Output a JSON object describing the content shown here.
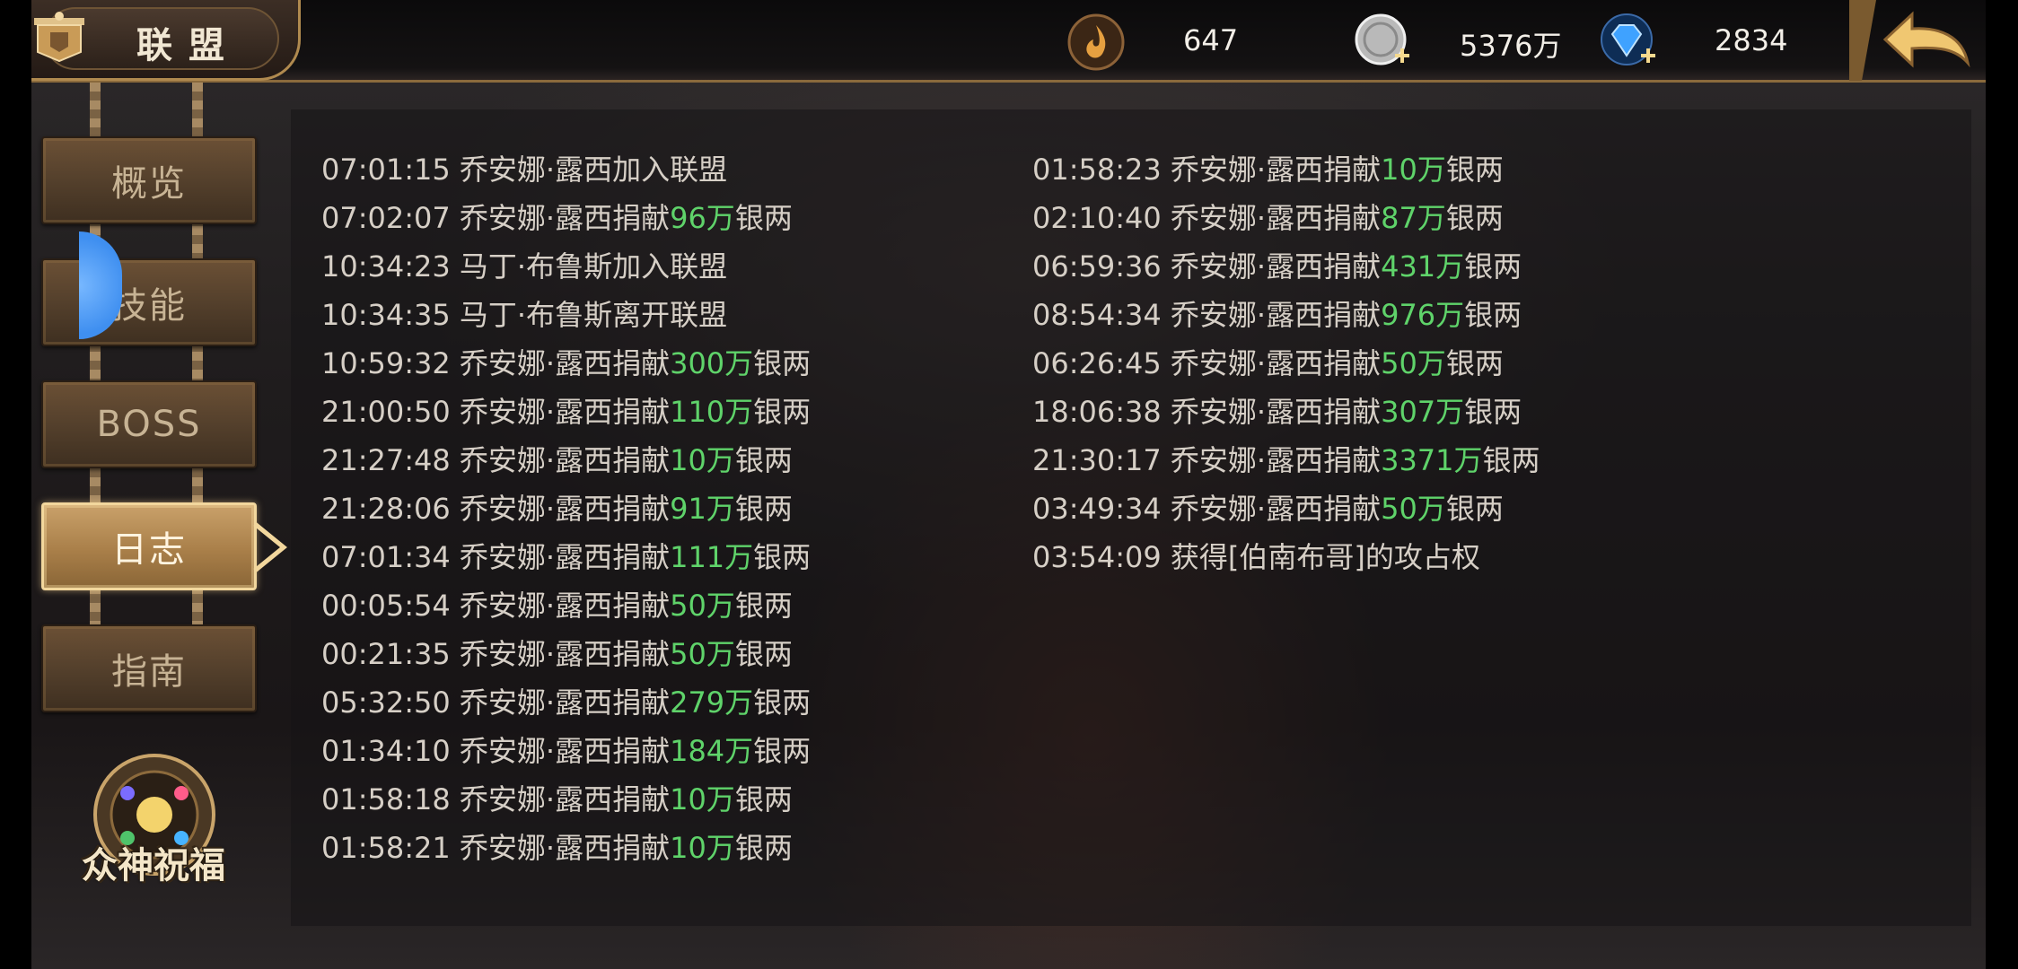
{
  "header": {
    "title": "联盟",
    "resources": [
      {
        "icon": "flame-coin-icon",
        "value": "647"
      },
      {
        "icon": "silver-coin-add-icon",
        "value": "5376万"
      },
      {
        "icon": "diamond-add-icon",
        "value": "2834"
      }
    ],
    "back_icon": "back-arrow-icon"
  },
  "sidebar": {
    "items": [
      {
        "label": "概览",
        "active": false
      },
      {
        "label": "技能",
        "active": false
      },
      {
        "label": "BOSS",
        "active": false
      },
      {
        "label": "日志",
        "active": true
      },
      {
        "label": "指南",
        "active": false
      }
    ],
    "blessing_label": "众神祝福"
  },
  "log": {
    "left": [
      {
        "time": "07:01:15",
        "pre": "乔安娜·露西加入联盟",
        "amt": "",
        "post": ""
      },
      {
        "time": "07:02:07",
        "pre": "乔安娜·露西捐献",
        "amt": "96万",
        "post": "银两"
      },
      {
        "time": "10:34:23",
        "pre": "马丁·布鲁斯加入联盟",
        "amt": "",
        "post": ""
      },
      {
        "time": "10:34:35",
        "pre": "马丁·布鲁斯离开联盟",
        "amt": "",
        "post": ""
      },
      {
        "time": "10:59:32",
        "pre": "乔安娜·露西捐献",
        "amt": "300万",
        "post": "银两"
      },
      {
        "time": "21:00:50",
        "pre": "乔安娜·露西捐献",
        "amt": "110万",
        "post": "银两"
      },
      {
        "time": "21:27:48",
        "pre": "乔安娜·露西捐献",
        "amt": "10万",
        "post": "银两"
      },
      {
        "time": "21:28:06",
        "pre": "乔安娜·露西捐献",
        "amt": "91万",
        "post": "银两"
      },
      {
        "time": "07:01:34",
        "pre": "乔安娜·露西捐献",
        "amt": "111万",
        "post": "银两"
      },
      {
        "time": "00:05:54",
        "pre": "乔安娜·露西捐献",
        "amt": "50万",
        "post": "银两"
      },
      {
        "time": "00:21:35",
        "pre": "乔安娜·露西捐献",
        "amt": "50万",
        "post": "银两"
      },
      {
        "time": "05:32:50",
        "pre": "乔安娜·露西捐献",
        "amt": "279万",
        "post": "银两"
      },
      {
        "time": "01:34:10",
        "pre": "乔安娜·露西捐献",
        "amt": "184万",
        "post": "银两"
      },
      {
        "time": "01:58:18",
        "pre": "乔安娜·露西捐献",
        "amt": "10万",
        "post": "银两"
      },
      {
        "time": "01:58:21",
        "pre": "乔安娜·露西捐献",
        "amt": "10万",
        "post": "银两"
      }
    ],
    "right": [
      {
        "time": "01:58:23",
        "pre": "乔安娜·露西捐献",
        "amt": "10万",
        "post": "银两"
      },
      {
        "time": "02:10:40",
        "pre": "乔安娜·露西捐献",
        "amt": "87万",
        "post": "银两"
      },
      {
        "time": "06:59:36",
        "pre": "乔安娜·露西捐献",
        "amt": "431万",
        "post": "银两"
      },
      {
        "time": "08:54:34",
        "pre": "乔安娜·露西捐献",
        "amt": "976万",
        "post": "银两"
      },
      {
        "time": "06:26:45",
        "pre": "乔安娜·露西捐献",
        "amt": "50万",
        "post": "银两"
      },
      {
        "time": "18:06:38",
        "pre": "乔安娜·露西捐献",
        "amt": "307万",
        "post": "银两"
      },
      {
        "time": "21:30:17",
        "pre": "乔安娜·露西捐献",
        "amt": "3371万",
        "post": "银两"
      },
      {
        "time": "03:49:34",
        "pre": "乔安娜·露西捐献",
        "amt": "50万",
        "post": "银两"
      },
      {
        "time": "03:54:09",
        "pre": "获得[伯南布哥]的攻占权",
        "amt": "",
        "post": ""
      }
    ]
  },
  "colors": {
    "amount_green": "#5fd36a",
    "gold_border": "#b08a4f",
    "log_text": "#d6cfc6"
  }
}
